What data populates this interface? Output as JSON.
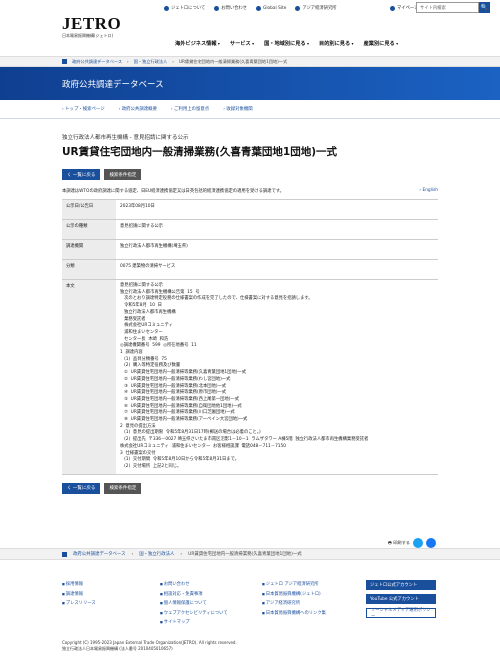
{
  "header": {
    "logo": "JETRO",
    "logo_sub": "日本貿易振興機構(ジェトロ)",
    "toplinks": [
      "ジェトロについて",
      "お問い合わせ",
      "Global Site",
      "アジア経済研究所"
    ],
    "mypage": "マイページ",
    "search_placeholder": "サイト内検索",
    "search_button": "🔍",
    "nav": [
      "海外ビジネス情報",
      "サービス",
      "国・地域別に見る",
      "目的別に見る",
      "産業別に見る"
    ]
  },
  "breadcrumb": [
    "政府公共調達データベース",
    "国・独立行政法人",
    "UR賃貸住宅団地内一般清掃業務(久喜青葉団地1団地)一式"
  ],
  "banner": "政府公共調達データベース",
  "subnav": [
    "トップ・検索ページ",
    "政府公共調達概要",
    "ご利用上の留意点",
    "收録対象機関"
  ],
  "category": "独立行政法人都市再生機構 - 意見招請に関する公示",
  "title": "UR賃貸住宅団地内一般清掃業務(久喜青葉団地1団地)一式",
  "buttons": {
    "back": "く 一覧に戻る",
    "cond": "検索条件指定"
  },
  "notice": "本調達はWTOの政府調達に関する協定、日EU経済連携協定又は日英包括的経済連携協定の適用を受ける調達です。",
  "english": "English",
  "table": [
    {
      "k": "公示日/公告日",
      "v": "2023年08月10日"
    },
    {
      "k": "公示の種類",
      "v": "意見招請に関する公示"
    },
    {
      "k": "調達機関",
      "v": "独立行政法人都市再生機構(埼玉県)"
    },
    {
      "k": "分類",
      "v": "0075 建築物の清掃サービス"
    }
  ],
  "honbun_label": "本文",
  "honbun": "意見招請に関する公示\n独立行政法人都市再生機構公告第  15  号\n   次のとおり調達特定役務の仕様書案の作成を完了したので、仕様書案に対する意見を招請します。\n   令和5年8月  10  日\n   独立行政法人都市再生機構\n   業務受託者\n   株式会社URコミュニティ\n   浦和住まいセンター\n   センター長  木崎  和浩\n◎調達機関番号  599  ◎所在地番号  11\n1  調達内容\n   (1)  品目分類番号  75\n   (2)  購入等特定役務及び数量\n   ①  UR賃貸住宅団地内一般清掃等業務(久喜青葉団地1団地)一式\n   ②  UR賃貸住宅団地内一般清掃等業務(わし宮団地)一式\n   ③  UR賃貸住宅団地内一般清掃等業務(北本団地)一式\n   ④  UR賃貸住宅団地内一般清掃等業務(原市団地)一式\n   ⑤  UR賃貸住宅団地内一般清掃等業務(西上尾第一団地)一式\n   ⑥  UR賃貸住宅団地内一般清掃等業務(自衛団地他1団地)一式\n   ⑦  UR賃貸住宅団地内一般清掃等業務(川口芝園団地)一式\n   ⑧  UR賃貸住宅団地内一般清掃等業務(アーベイン大宮団地)一式\n2  意見の提出方法\n   (1)  意見の提出期限  令和5年8月31日17時(郵送の場合は必着のこと。)\n   (2)  提出先  〒336－0027 埼玉県さいたま市南区沼影1－10－1  ラムザタワー A棟5階  独立行政法人都市再生機構業務受託者\n株式会社URコミュニティ  浦和住まいセンター  お客様相談課  電話048－711－7150\n3  仕様書案の交付\n   (1)  交付期間  令和5年8月10日から令和5年8月31日まで。\n   (2)  交付場所  上記2と同じ。",
  "share_label": "印刷する",
  "footer": {
    "col1": [
      "採用情報",
      "調達情報",
      "プレスリリース"
    ],
    "col2": [
      "お問い合わせ",
      "相談対応・免責事項",
      "個人情報保護について",
      "ウェブアクセシビリティについて",
      "サイトマップ"
    ],
    "col3": [
      "ジェトロ アジア経済研究所",
      "日本貿易振興機構(ジェトロ)",
      "アジア経済研究所",
      "日本貿易振興機構へのリンク集"
    ],
    "sns": [
      "ジェトロ公式アカウント",
      "YouTube 公式アカウント",
      "ソーシャルメディア運用ポリシー"
    ]
  },
  "copyright": "Copyright (C) 1995-2023 Japan External Trade Organization(JETRO). All rights reserved.",
  "corp_no": "独立行政法人日本貿易振興機構 (法人番号 2010405010657)"
}
